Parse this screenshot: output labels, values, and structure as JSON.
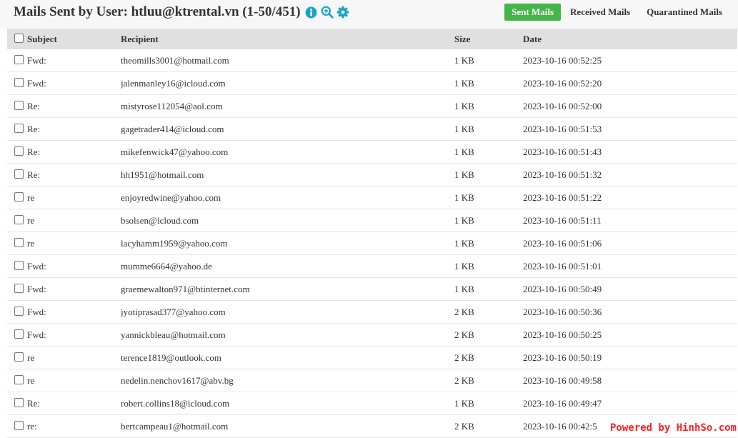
{
  "header": {
    "title": "Mails Sent by User: htluu@ktrental.vn (1-50/451)",
    "icons": [
      "info-icon",
      "zoom-in-icon",
      "gear-icon"
    ],
    "tabs": [
      {
        "label": "Sent Mails",
        "active": true
      },
      {
        "label": "Received Mails",
        "active": false
      },
      {
        "label": "Quarantined Mails",
        "active": false
      }
    ]
  },
  "colors": {
    "accent": "#45b549",
    "icon": "#1aa3c8",
    "header_bg": "#f7f7f7",
    "table_header_bg": "#e0e0e0",
    "watermark": "#ff1e1e"
  },
  "table": {
    "columns": [
      "Subject",
      "Recipient",
      "Size",
      "Date"
    ],
    "rows": [
      {
        "subject": "Fwd:",
        "recipient": "theomills3001@hotmail.com",
        "size": "1 KB",
        "date": "2023-10-16 00:52:25"
      },
      {
        "subject": "Fwd:",
        "recipient": "jalenmanley16@icloud.com",
        "size": "1 KB",
        "date": "2023-10-16 00:52:20"
      },
      {
        "subject": "Re:",
        "recipient": "mistyrose112054@aol.com",
        "size": "1 KB",
        "date": "2023-10-16 00:52:00"
      },
      {
        "subject": "Re:",
        "recipient": "gagetrader414@icloud.com",
        "size": "1 KB",
        "date": "2023-10-16 00:51:53"
      },
      {
        "subject": "Re:",
        "recipient": "mikefenwick47@yahoo.com",
        "size": "1 KB",
        "date": "2023-10-16 00:51:43"
      },
      {
        "subject": "Re:",
        "recipient": "hh1951@hotmail.com",
        "size": "1 KB",
        "date": "2023-10-16 00:51:32"
      },
      {
        "subject": "re",
        "recipient": "enjoyredwine@yahoo.com",
        "size": "1 KB",
        "date": "2023-10-16 00:51:22"
      },
      {
        "subject": "re",
        "recipient": "bsolsen@icloud.com",
        "size": "1 KB",
        "date": "2023-10-16 00:51:11"
      },
      {
        "subject": "re",
        "recipient": "lacyhamm1959@yahoo.com",
        "size": "1 KB",
        "date": "2023-10-16 00:51:06"
      },
      {
        "subject": "Fwd:",
        "recipient": "mumme6664@yahoo.de",
        "size": "1 KB",
        "date": "2023-10-16 00:51:01"
      },
      {
        "subject": "Fwd:",
        "recipient": "graemewalton971@btinternet.com",
        "size": "1 KB",
        "date": "2023-10-16 00:50:49"
      },
      {
        "subject": "Fwd:",
        "recipient": "jyotiprasad377@yahoo.com",
        "size": "2 KB",
        "date": "2023-10-16 00:50:36"
      },
      {
        "subject": "Fwd:",
        "recipient": "yannickbleau@hotmail.com",
        "size": "2 KB",
        "date": "2023-10-16 00:50:25"
      },
      {
        "subject": "re",
        "recipient": "terence1819@outlook.com",
        "size": "2 KB",
        "date": "2023-10-16 00:50:19"
      },
      {
        "subject": "re",
        "recipient": "nedelin.nenchov1617@abv.bg",
        "size": "2 KB",
        "date": "2023-10-16 00:49:58"
      },
      {
        "subject": "Re:",
        "recipient": "robert.collins18@icloud.com",
        "size": "1 KB",
        "date": "2023-10-16 00:49:47"
      },
      {
        "subject": "re:",
        "recipient": "bertcampeau1@hotmail.com",
        "size": "2 KB",
        "date": "2023-10-16 00:42:5"
      }
    ]
  },
  "watermark": "Powered by HinhSo.com"
}
